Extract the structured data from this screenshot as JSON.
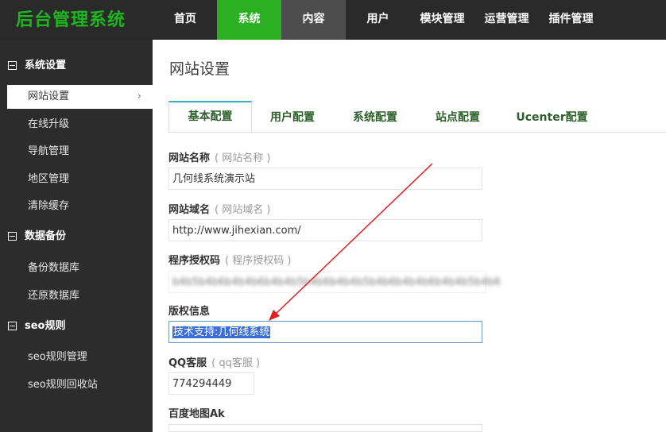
{
  "app": {
    "title": "后台管理系统"
  },
  "nav": {
    "items": [
      "首页",
      "系统",
      "内容",
      "用户",
      "模块管理",
      "运营管理",
      "插件管理"
    ]
  },
  "sidebar": {
    "groups": [
      {
        "title": "系统设置",
        "items": [
          "网站设置",
          "在线升级",
          "导航管理",
          "地区管理",
          "清除缓存"
        ]
      },
      {
        "title": "数据备份",
        "items": [
          "备份数据库",
          "还原数据库"
        ]
      },
      {
        "title": "seo规则",
        "items": [
          "seo规则管理",
          "seo规则回收站"
        ]
      }
    ]
  },
  "page": {
    "title": "网站设置"
  },
  "tabs": [
    "基本配置",
    "用户配置",
    "系统配置",
    "站点配置",
    "Ucenter配置"
  ],
  "fields": {
    "site_name": {
      "label": "网站名称",
      "hint": "( 网站名称 )",
      "value": "几何线系统演示站"
    },
    "site_domain": {
      "label": "网站域名",
      "hint": "( 网站域名 )",
      "value": "http://www.jihexian.com/"
    },
    "license": {
      "label": "程序授权码",
      "hint": "( 程序授权码 )",
      "value": "b4b5b4b6b4b4b6b4b4b5b4b6b4b4b5b4b6b4b4b6b4b4b5b4b6"
    },
    "copyright": {
      "label": "版权信息",
      "value": "技术支持:几何线系统"
    },
    "qq": {
      "label": "QQ客服",
      "hint": "( qq客服 )",
      "value": "774294449"
    },
    "baidu_ak": {
      "label": "百度地图Ak",
      "value": ""
    }
  },
  "colors": {
    "accent": "#2bb024",
    "tab_text": "#2d5f2d",
    "tab_top": "#36b0c7",
    "arrow": "#e02020"
  }
}
